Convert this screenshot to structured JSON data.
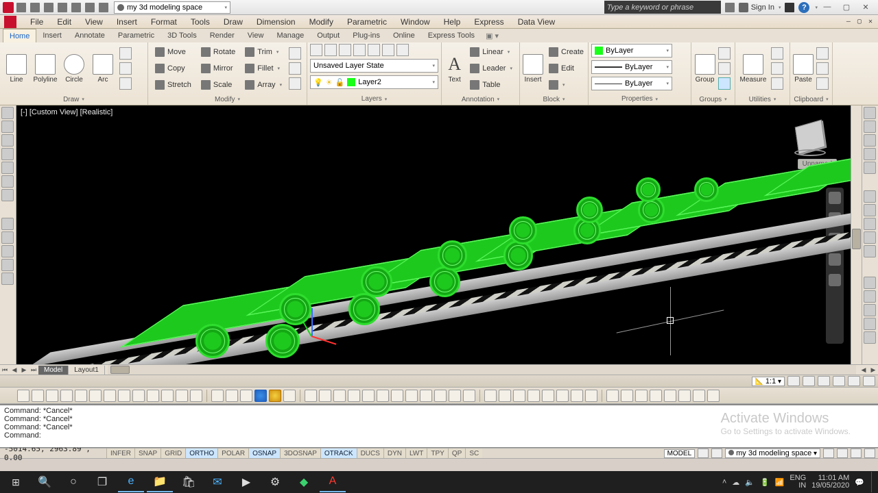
{
  "titlebar": {
    "workspace": "my 3d modeling space",
    "search_placeholder": "Type a keyword or phrase",
    "signin": "Sign In"
  },
  "menus": [
    "File",
    "Edit",
    "View",
    "Insert",
    "Format",
    "Tools",
    "Draw",
    "Dimension",
    "Modify",
    "Parametric",
    "Window",
    "Help",
    "Express",
    "Data View"
  ],
  "tabs": [
    "Home",
    "Insert",
    "Annotate",
    "Parametric",
    "3D Tools",
    "Render",
    "View",
    "Manage",
    "Output",
    "Plug-ins",
    "Online",
    "Express Tools"
  ],
  "ribbon": {
    "draw": {
      "title": "Draw",
      "line": "Line",
      "polyline": "Polyline",
      "circle": "Circle",
      "arc": "Arc"
    },
    "modify": {
      "title": "Modify",
      "move": "Move",
      "copy": "Copy",
      "stretch": "Stretch",
      "rotate": "Rotate",
      "mirror": "Mirror",
      "scale": "Scale",
      "trim": "Trim",
      "fillet": "Fillet",
      "array": "Array"
    },
    "layers": {
      "title": "Layers",
      "state": "Unsaved Layer State",
      "current": "Layer2"
    },
    "annotation": {
      "title": "Annotation",
      "text": "Text",
      "linear": "Linear",
      "leader": "Leader",
      "table": "Table"
    },
    "block": {
      "title": "Block",
      "insert": "Insert",
      "create": "Create",
      "edit": "Edit"
    },
    "properties": {
      "title": "Properties",
      "color": "ByLayer",
      "ltype": "ByLayer",
      "lweight": "ByLayer"
    },
    "groups": {
      "title": "Groups",
      "group": "Group"
    },
    "utilities": {
      "title": "Utilities",
      "measure": "Measure"
    },
    "clipboard": {
      "title": "Clipboard",
      "paste": "Paste"
    }
  },
  "viewport": {
    "label": "[-] [Custom View] [Realistic]",
    "unnamed": "Unnamed"
  },
  "layout": {
    "model": "Model",
    "layout1": "Layout1"
  },
  "scale": "1:1",
  "cmd": {
    "l1": "Command: *Cancel*",
    "l2": "Command: *Cancel*",
    "l3": "Command: *Cancel*",
    "prompt": "Command:"
  },
  "watermark": {
    "t1": "Activate Windows",
    "t2": "Go to Settings to activate Windows."
  },
  "coords": "-5014.65, 2963.89 , 0.00",
  "toggles": [
    "INFER",
    "SNAP",
    "GRID",
    "ORTHO",
    "POLAR",
    "OSNAP",
    "3DOSNAP",
    "OTRACK",
    "DUCS",
    "DYN",
    "LWT",
    "TPY",
    "QP",
    "SC"
  ],
  "toggles_on": [
    "ORTHO",
    "OSNAP",
    "OTRACK"
  ],
  "status_right": {
    "model": "MODEL",
    "ws": "my 3d modeling space"
  },
  "tray": {
    "lang1": "ENG",
    "lang2": "IN",
    "time": "11:01 AM",
    "date": "19/05/2020"
  }
}
